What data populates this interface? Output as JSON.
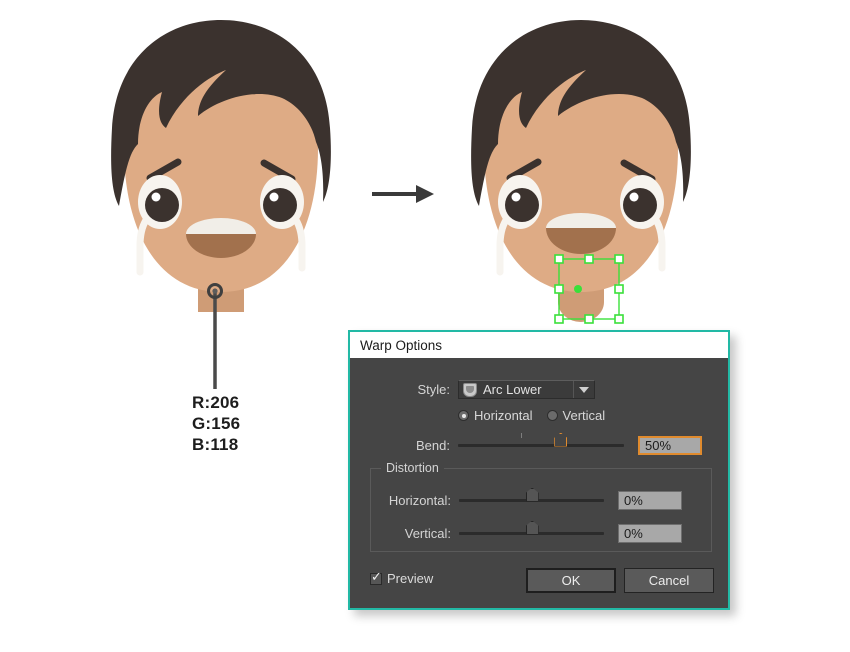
{
  "illustration": {
    "left_figure_name": "crying-boy-original",
    "right_figure_name": "crying-boy-warped",
    "arrow_name": "transform-arrow",
    "colors": {
      "hair": "#3b322e",
      "skin": "#deab85",
      "skin_shadow": "#cf9c76",
      "mouth": "#a2714d",
      "mouth_highlight": "#f1eee8",
      "eye_white": "#f7f4ef",
      "pupil": "#3b322e",
      "tear": "#f7f4ef",
      "neck": "#cf9c76",
      "pin": "#4a4a4a",
      "selection": "#3ae03a"
    }
  },
  "rgb_callout": {
    "name": "color-readout",
    "lines": [
      "R:206",
      "G:156",
      "B:118"
    ],
    "r_label": "R:206",
    "g_label": "G:156",
    "b_label": "B:118",
    "swatch_hex": "#ce9c76"
  },
  "dialog": {
    "title": "Warp Options",
    "style": {
      "label": "Style:",
      "value": "Arc Lower",
      "icon": "arc-lower-glyph",
      "caret": "chevron-down-icon"
    },
    "orientation": {
      "horizontal_label": "Horizontal",
      "vertical_label": "Vertical",
      "selected": "Horizontal"
    },
    "bend": {
      "label": "Bend:",
      "value": "50%",
      "slider_percent": 62,
      "tick_percent": 38
    },
    "distortion": {
      "legend": "Distortion",
      "horizontal": {
        "label": "Horizontal:",
        "value": "0%",
        "slider_percent": 50
      },
      "vertical": {
        "label": "Vertical:",
        "value": "0%",
        "slider_percent": 50
      }
    },
    "footer": {
      "preview_label": "Preview",
      "preview_checked": true,
      "ok_label": "OK",
      "cancel_label": "Cancel"
    },
    "accent_border": "#22b9a5",
    "focus_accent": "#e08b2e"
  }
}
